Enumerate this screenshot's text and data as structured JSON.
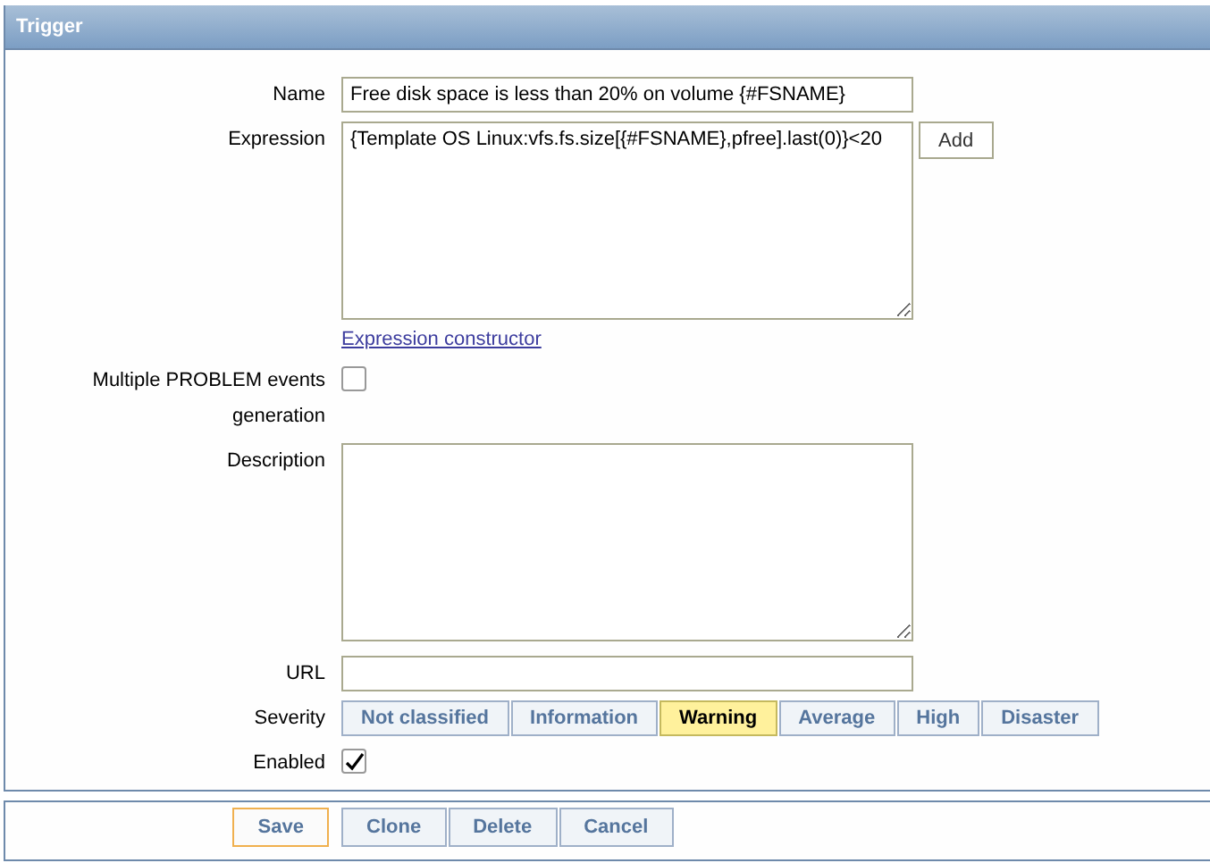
{
  "header": {
    "title": "Trigger"
  },
  "name": {
    "label": "Name",
    "value": "Free disk space is less than 20% on volume {#FSNAME}"
  },
  "expression": {
    "label": "Expression",
    "value": "{Template OS Linux:vfs.fs.size[{#FSNAME},pfree].last(0)}<20",
    "add_button": "Add",
    "link": "Expression constructor"
  },
  "multiple_events": {
    "label": "Multiple PROBLEM events generation",
    "checked": false
  },
  "description": {
    "label": "Description"
  },
  "url": {
    "label": "URL"
  },
  "severity": {
    "label": "Severity",
    "options": [
      {
        "label": "Not classified",
        "selected": false
      },
      {
        "label": "Information",
        "selected": false
      },
      {
        "label": "Warning",
        "selected": true
      },
      {
        "label": "Average",
        "selected": false
      },
      {
        "label": "High",
        "selected": false
      },
      {
        "label": "Disaster",
        "selected": false
      }
    ]
  },
  "enabled": {
    "label": "Enabled",
    "checked": true
  },
  "buttons": [
    {
      "label": "Save",
      "kind": "primary"
    },
    {
      "label": "Clone",
      "kind": "group"
    },
    {
      "label": "Delete",
      "kind": "group"
    },
    {
      "label": "Cancel",
      "kind": "group"
    }
  ]
}
